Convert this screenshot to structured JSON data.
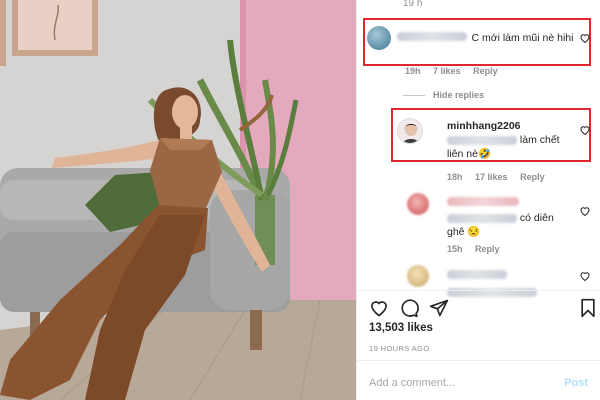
{
  "comments": [
    {
      "top_meta": "19 h",
      "text": "C mới làm mũi nè hihi",
      "time": "19h",
      "likes": "7 likes",
      "reply": "Reply"
    }
  ],
  "hide_replies": "Hide replies",
  "replies": [
    {
      "username": "minhhang2206",
      "text_after_mention": "làm chết",
      "text_line2": "liên nè🤣",
      "time": "18h",
      "likes": "17 likes",
      "reply": "Reply"
    },
    {
      "text_after_mention": "có diên",
      "text_line2": "ghê 😒",
      "time": "15h",
      "reply": "Reply"
    }
  ],
  "post": {
    "likes": "13,503 likes",
    "time_ago": "19 HOURS AGO"
  },
  "composer": {
    "placeholder": "Add a comment...",
    "post_label": "Post"
  },
  "icons": [
    "heart-icon",
    "comment-icon",
    "share-icon",
    "bookmark-icon"
  ],
  "colors": {
    "highlight_box": "#e0262f",
    "post_button": "#b2dffc",
    "wall_pink": "#e5a9bd"
  }
}
